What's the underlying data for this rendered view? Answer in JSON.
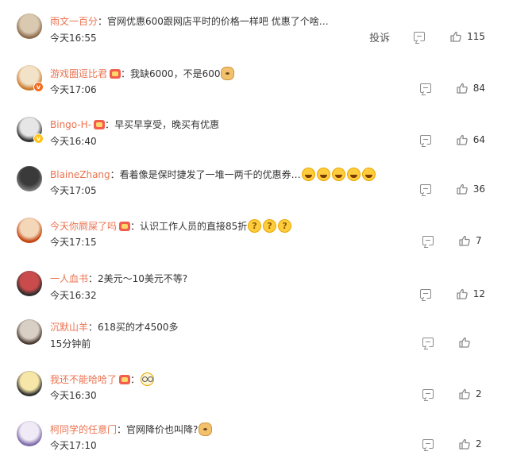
{
  "comments": [
    {
      "user": "雨文一百分",
      "text": "官网优惠600跟网店平时的价格一样吧 优惠了个啥…",
      "time": "今天16:55",
      "likes": "115",
      "show_report": true,
      "report_label": "投诉",
      "member": false,
      "verified": "",
      "emojis": [],
      "avatar_colors": [
        "#d9c9b1",
        "#8b6b4a"
      ]
    },
    {
      "user": "游戏圈逗比君",
      "text": "我缺6000，不是600",
      "time": "今天17:06",
      "likes": "84",
      "show_report": false,
      "member": true,
      "verified": "red",
      "emojis": [
        "doge"
      ],
      "avatar_colors": [
        "#f2e2c8",
        "#c97a2b"
      ]
    },
    {
      "user": "Bingo-H-",
      "text": "早买早享受，晚买有优惠",
      "time": "今天16:40",
      "likes": "64",
      "show_report": false,
      "member": true,
      "verified": "yellow",
      "emojis": [],
      "avatar_colors": [
        "#e6e6e6",
        "#2e2e2e"
      ]
    },
    {
      "user": "BlaineZhang",
      "text": "看着像是保时捷发了一堆一两千的优惠券…",
      "time": "今天17:05",
      "likes": "36",
      "show_report": false,
      "member": false,
      "verified": "",
      "emojis": [
        "laugh",
        "laugh",
        "laugh",
        "laugh",
        "laugh"
      ],
      "avatar_colors": [
        "#3a3a3a",
        "#777777"
      ]
    },
    {
      "user": "今天你屙屎了吗",
      "text": "认识工作人员的直接85折",
      "time": "今天17:15",
      "likes": "7",
      "show_report": false,
      "member": true,
      "verified": "",
      "emojis": [
        "think",
        "think",
        "think"
      ],
      "avatar_colors": [
        "#f3d7b8",
        "#c2410c"
      ]
    },
    {
      "user": "一人血书",
      "text": "2美元～10美元不等?",
      "time": "今天16:32",
      "likes": "12",
      "show_report": false,
      "member": false,
      "verified": "",
      "emojis": [],
      "avatar_colors": [
        "#c94b4b",
        "#2b2b2b"
      ]
    },
    {
      "user": "沉默山羊",
      "text": "618买的才4500多",
      "time": "15分钟前",
      "likes": "",
      "show_report": false,
      "member": false,
      "verified": "",
      "emojis": [],
      "avatar_colors": [
        "#d8cfc5",
        "#4a3b32"
      ]
    },
    {
      "user": "我还不能哈哈了",
      "text": "",
      "time": "今天16:30",
      "likes": "2",
      "show_report": false,
      "member": true,
      "verified": "",
      "emojis": [
        "glasses"
      ],
      "avatar_colors": [
        "#f6e6a8",
        "#2b2b2b"
      ]
    },
    {
      "user": "柯同学的任意门",
      "text": "官网降价也叫降?",
      "time": "今天17:10",
      "likes": "2",
      "show_report": false,
      "member": false,
      "verified": "",
      "emojis": [
        "doge"
      ],
      "avatar_colors": [
        "#efeaf5",
        "#7d6aa8"
      ]
    }
  ]
}
